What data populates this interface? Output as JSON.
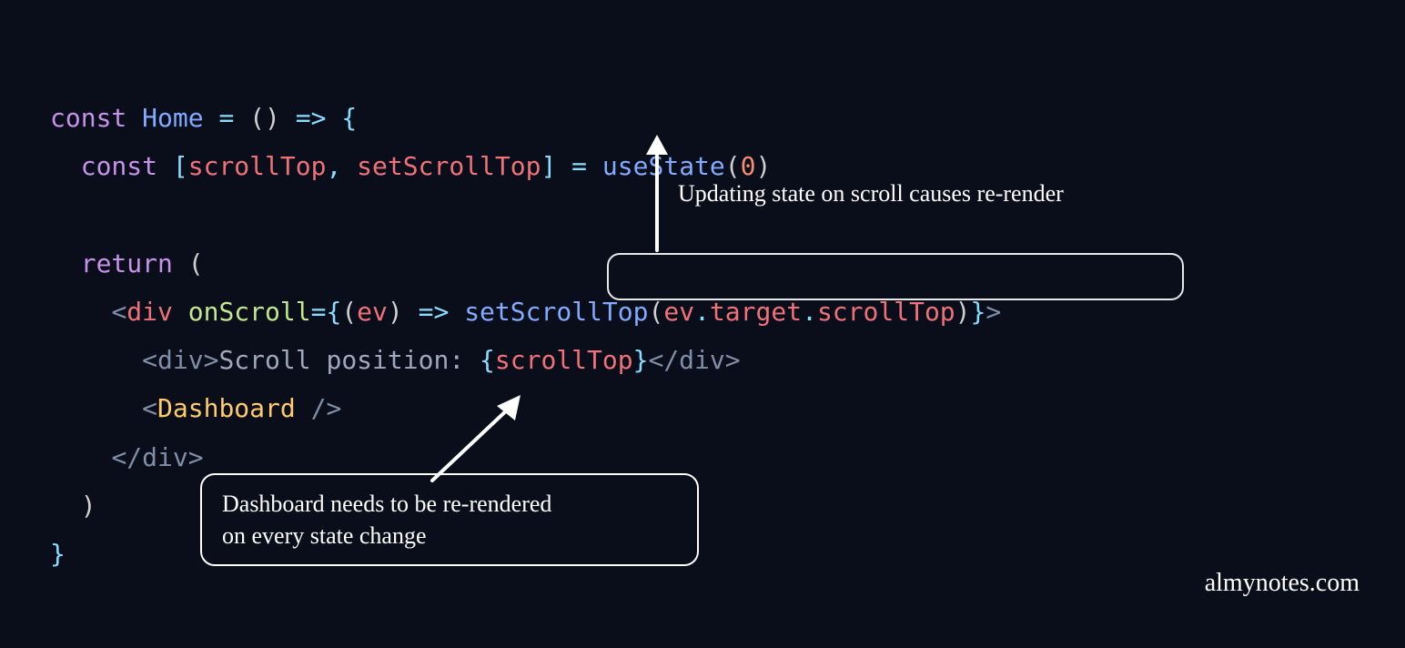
{
  "code": {
    "line1": {
      "kw_const": "const",
      "fn_home": "Home",
      "eq": " = ",
      "parens": "()",
      "arrow": " => ",
      "brace": "{"
    },
    "line2": {
      "kw_const": "const",
      "bracket_open": " [",
      "var_scrolltop": "scrollTop",
      "comma": ", ",
      "var_setscrolltop": "setScrollTop",
      "bracket_close": "]",
      "eq": " = ",
      "fn_usestate": "useState",
      "paren_open": "(",
      "num_zero": "0",
      "paren_close": ")"
    },
    "line4": {
      "kw_return": "return",
      "paren": " ("
    },
    "line5": {
      "lt": "<",
      "tag_div": "div",
      "attr_onscroll": "onScroll",
      "eq": "=",
      "brace_open": "{",
      "paren_open": "(",
      "param_ev": "ev",
      "paren_close": ")",
      "arrow": " => ",
      "fn_set": "setScrollTop",
      "call_open": "(",
      "obj_ev": "ev",
      "dot1": ".",
      "prop_target": "target",
      "dot2": ".",
      "prop_scrolltop": "scrollTop",
      "call_close": ")",
      "brace_close": "}",
      "gt": ">"
    },
    "line6": {
      "open": "<div>",
      "text": "Scroll position: ",
      "brace_open": "{",
      "var": "scrollTop",
      "brace_close": "}",
      "close": "</div>"
    },
    "line7": {
      "lt": "<",
      "tag": "Dashboard",
      "close": " />"
    },
    "line8": {
      "close_div": "</div>"
    },
    "line9": {
      "paren": ")"
    },
    "line10": {
      "brace": "}"
    }
  },
  "annotations": {
    "top": "Updating state on scroll causes re-render",
    "bottom_line1": "Dashboard needs to be re-rendered",
    "bottom_line2": "on every state change"
  },
  "watermark": "almynotes.com"
}
